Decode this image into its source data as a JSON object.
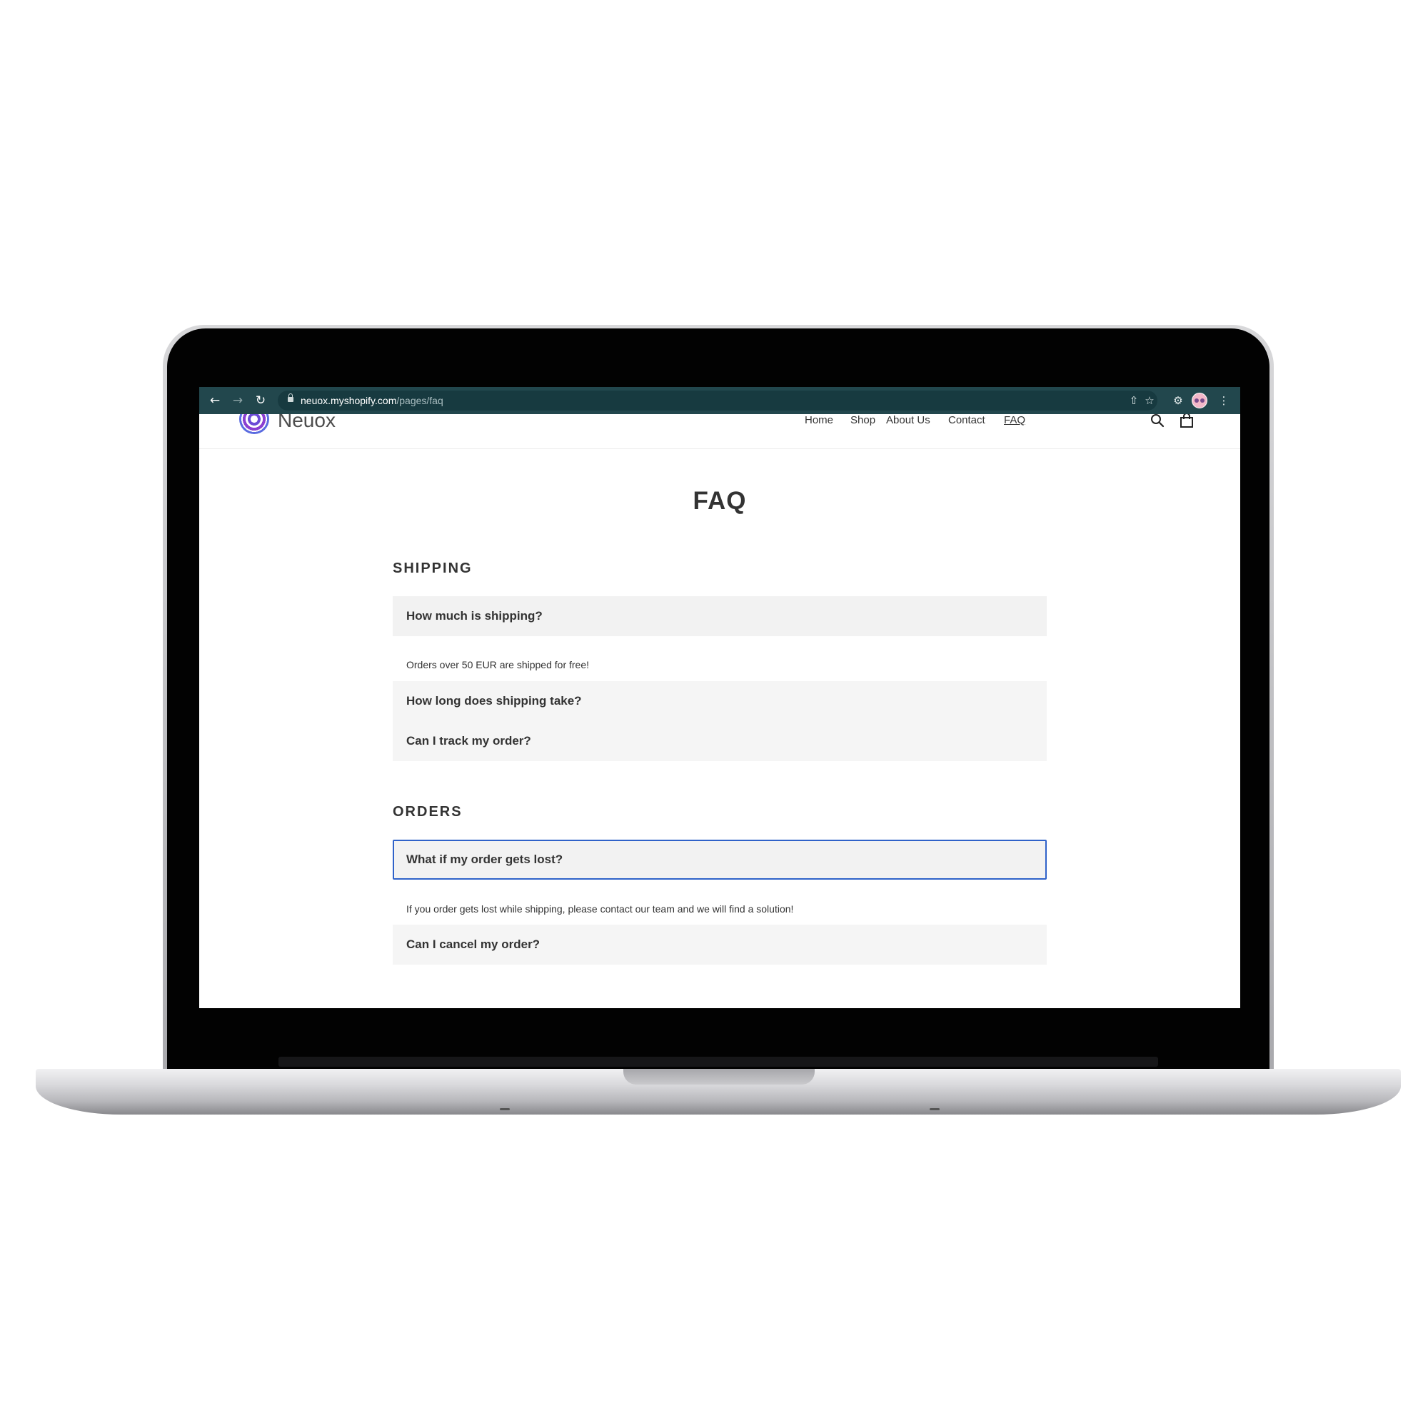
{
  "browser": {
    "url_host": "neuox.myshopify.com",
    "url_path": "/pages/faq"
  },
  "site": {
    "logo_text": "Neuox",
    "nav": [
      "Home",
      "Shop",
      "About Us",
      "Contact",
      "FAQ"
    ],
    "active_nav": "FAQ"
  },
  "page": {
    "title": "FAQ",
    "sections": [
      {
        "heading": "SHIPPING",
        "items": [
          {
            "question": "How much is shipping?",
            "answer": "Orders over 50 EUR are shipped for free!",
            "expanded": true
          },
          {
            "question": "How long does shipping take?",
            "expanded": false
          },
          {
            "question": "Can I track my order?",
            "expanded": false
          }
        ]
      },
      {
        "heading": "ORDERS",
        "items": [
          {
            "question": "What if my order gets lost?",
            "answer": "If you order gets lost while shipping, please contact our team and we will find a solution!",
            "expanded": true,
            "focused": true
          },
          {
            "question": "Can I cancel my order?",
            "expanded": false
          }
        ]
      }
    ]
  },
  "colors": {
    "browser_toolbar": "#22474d",
    "focus_ring": "#2f62c9",
    "question_bg": "#f2f2f2"
  }
}
